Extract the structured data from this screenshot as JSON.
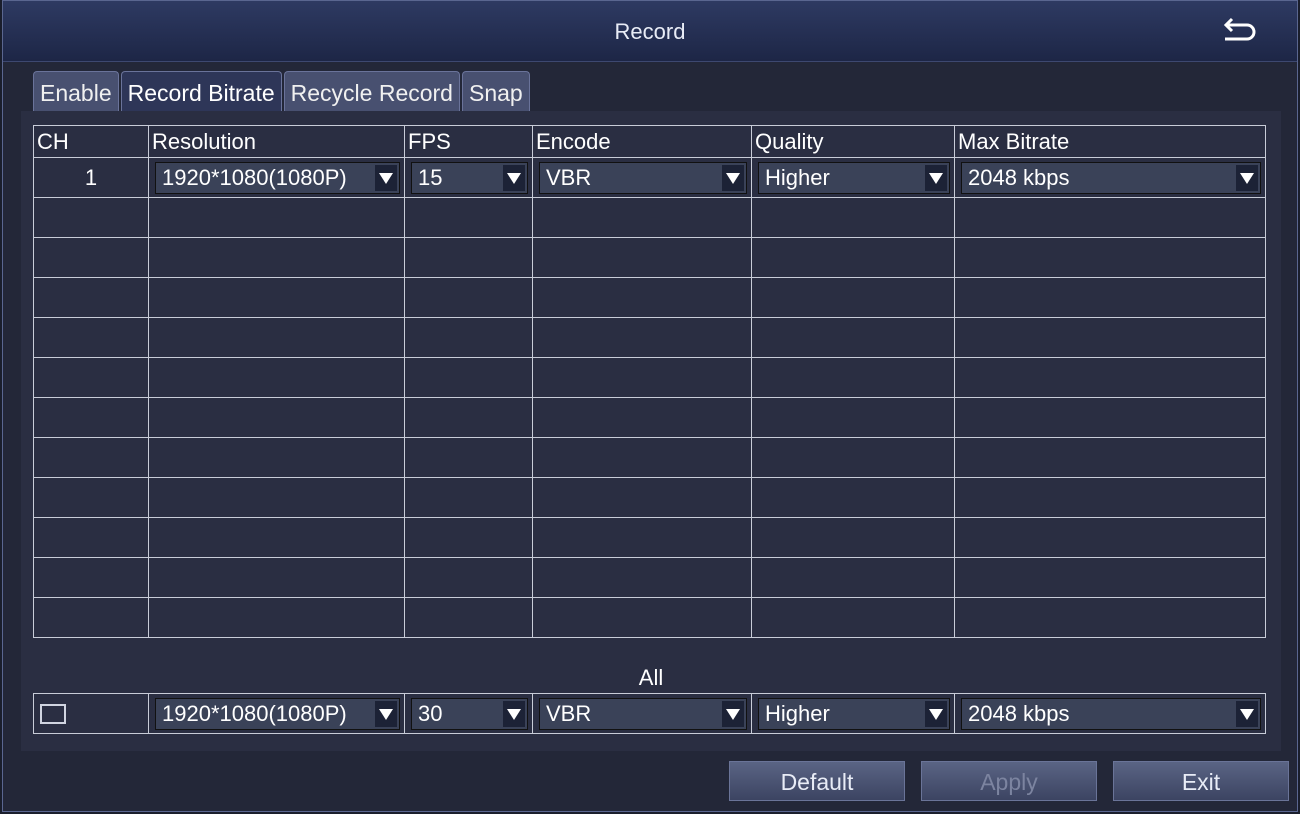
{
  "window": {
    "title": "Record"
  },
  "tabs": [
    {
      "label": "Enable",
      "active": false
    },
    {
      "label": "Record Bitrate",
      "active": true
    },
    {
      "label": "Recycle Record",
      "active": false
    },
    {
      "label": "Snap",
      "active": false
    }
  ],
  "table": {
    "headers": [
      "CH",
      "Resolution",
      "FPS",
      "Encode",
      "Quality",
      "Max Bitrate"
    ],
    "rows": [
      {
        "ch": "1",
        "resolution": "1920*1080(1080P)",
        "fps": "15",
        "encode": "VBR",
        "quality": "Higher",
        "max_bitrate": "2048 kbps"
      }
    ],
    "empty_rows": 11
  },
  "all": {
    "label": "All",
    "checked": false,
    "resolution": "1920*1080(1080P)",
    "fps": "30",
    "encode": "VBR",
    "quality": "Higher",
    "max_bitrate": "2048 kbps"
  },
  "buttons": {
    "default": "Default",
    "apply": "Apply",
    "exit": "Exit"
  },
  "colors": {
    "title_bar": "#2e3a62",
    "panel": "#2a2e42",
    "grid_line": "#c8ccd8",
    "disabled_text": "#7c84a0"
  }
}
